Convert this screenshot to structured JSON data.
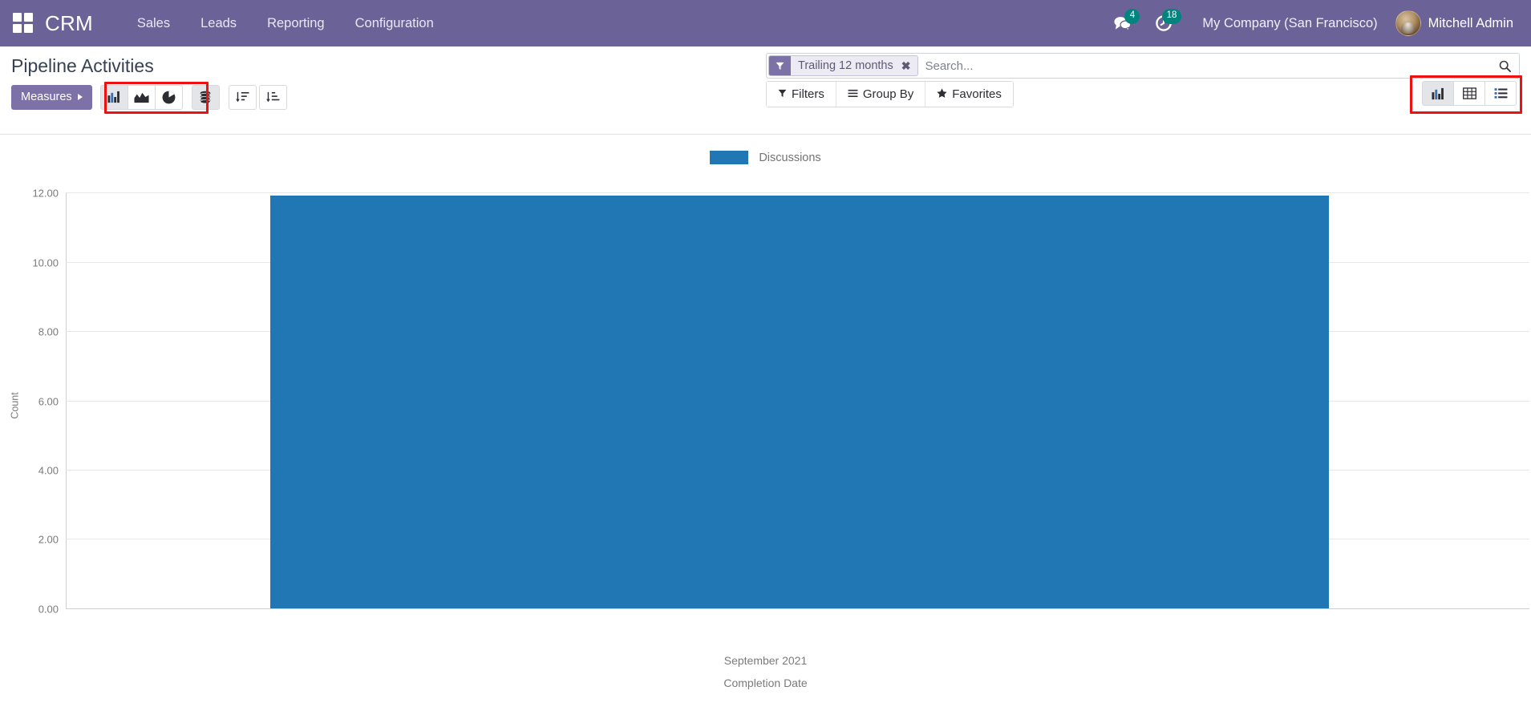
{
  "navbar": {
    "apps_icon": "apps-grid-icon",
    "brand": "CRM",
    "menu_items": [
      {
        "label": "Sales"
      },
      {
        "label": "Leads"
      },
      {
        "label": "Reporting"
      },
      {
        "label": "Configuration"
      }
    ],
    "messages_icon": "messages-icon",
    "messages_count": "4",
    "activities_icon": "clock-activity-icon",
    "activities_count": "18",
    "company": "My Company (San Francisco)",
    "user": "Mitchell Admin",
    "avatar_icon": "user-avatar",
    "accent_color": "#6b6397",
    "badge_color": "#00847e"
  },
  "control_panel": {
    "title": "Pipeline Activities",
    "measures_label": "Measures",
    "graph_type_buttons": [
      {
        "name": "bar-chart-icon",
        "active": true
      },
      {
        "name": "area-chart-icon",
        "active": false
      },
      {
        "name": "pie-chart-icon",
        "active": false
      }
    ],
    "stacked_button": {
      "name": "database-stack-icon",
      "active": true
    },
    "sort_buttons": [
      {
        "name": "sort-descending-icon"
      },
      {
        "name": "sort-ascending-icon"
      }
    ],
    "highlight_color": "#ee1111"
  },
  "search": {
    "facet": {
      "icon": "filter-funnel-icon",
      "label": "Trailing 12 months",
      "close": "✖"
    },
    "placeholder": "Search...",
    "search_icon": "magnifier-icon"
  },
  "filter_menus": [
    {
      "label": "Filters",
      "icon": "filter-funnel-icon"
    },
    {
      "label": "Group By",
      "icon": "hamburger-lines-icon"
    },
    {
      "label": "Favorites",
      "icon": "star-icon"
    }
  ],
  "view_switcher": [
    {
      "name": "graph-view-icon",
      "active": true
    },
    {
      "name": "pivot-view-icon",
      "active": false
    },
    {
      "name": "list-view-icon",
      "active": false
    }
  ],
  "chart_data": {
    "type": "bar",
    "title": "",
    "categories": [
      "September 2021"
    ],
    "series": [
      {
        "name": "Discussions",
        "values": [
          12
        ],
        "color": "#2077b4"
      }
    ],
    "values": [
      12
    ],
    "xlabel": "Completion Date",
    "ylabel": "Count",
    "ylim": [
      0,
      12
    ],
    "yticks": [
      "0.00",
      "2.00",
      "4.00",
      "6.00",
      "8.00",
      "10.00",
      "12.00"
    ],
    "ytick_values": [
      0,
      2,
      4,
      6,
      8,
      10,
      12
    ],
    "grid": true,
    "legend": {
      "position": "top",
      "entries": [
        "Discussions"
      ]
    }
  }
}
